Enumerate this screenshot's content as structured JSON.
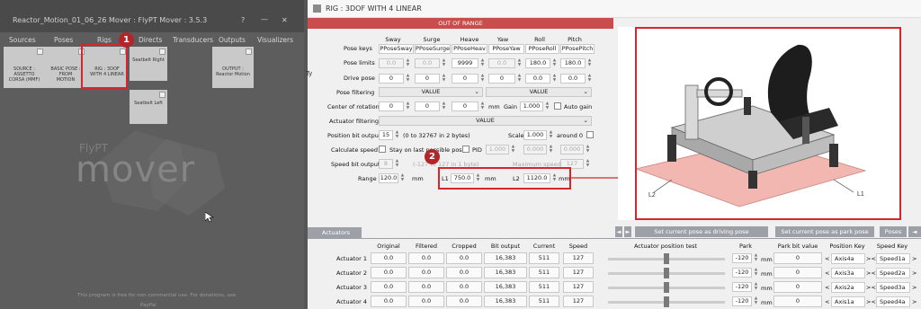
{
  "main_window": {
    "title": "Reactor_Motion_01_06_26 Mover : FlyPT Mover : 3.5.3",
    "win_controls": [
      "?",
      "—",
      "✕"
    ],
    "tabs": [
      "Sources",
      "Poses",
      "Rigs",
      "Directs",
      "Transducers",
      "Outputs",
      "Visualizers"
    ],
    "tiles": {
      "source": "SOURCE :\nASSETTO\nCORSA (MMF)",
      "pose": "BASIC POSE :\nFROM\nMOTION",
      "rig": "RIG : 3DOF\nWITH 4 LINEAR",
      "directs": "Seatbelt Right",
      "output": "OUTPUT :\nReactor Motion",
      "directs2": "Seatbelt Left"
    },
    "logo_small": "FlyPT",
    "logo_big": "mover",
    "footer": "This program is free for non commercial use. For donations, use",
    "footer2": "PayPal",
    "markers": {
      "one": "1",
      "two": "2"
    }
  },
  "rig_window": {
    "title": "RIG : 3DOF WITH 4 LINEAR",
    "banner": "OUT OF RANGE",
    "side_label": "Ty",
    "headers": [
      "Sway",
      "Surge",
      "Heave",
      "Yaw",
      "Roll",
      "Pitch"
    ],
    "pose_keys": {
      "label": "Pose keys",
      "values": [
        "PPoseSway",
        "PPoseSurge",
        "PPoseHeav",
        "PPoseYaw",
        "PPoseRoll",
        "PPosePitch"
      ]
    },
    "pose_limits": {
      "label": "Pose limits",
      "values": [
        "0.0",
        "0.0",
        "9999",
        "0.0",
        "180.0",
        "180.0"
      ]
    },
    "drive_pose": {
      "label": "Drive pose",
      "values": [
        "0",
        "0",
        "0",
        "0",
        "0.0",
        "0.0"
      ]
    },
    "pose_filtering": {
      "label": "Pose filtering",
      "left": "VALUE",
      "right": "VALUE"
    },
    "center_of_rotation": {
      "label": "Center of rotation",
      "values": [
        "0",
        "0",
        "0"
      ],
      "unit": "mm",
      "gain_label": "Gain",
      "gain": "1.000",
      "auto_gain": "Auto gain"
    },
    "actuator_filtering": {
      "label": "Actuator filtering",
      "value": "VALUE"
    },
    "position_bit_output": {
      "label": "Position bit output",
      "value": "15",
      "note": "(0 to 32767 in 2 bytes)",
      "scale_label": "Scale",
      "scale": "1.000",
      "around": "around 0"
    },
    "calculate_speed": {
      "label": "Calculate speed",
      "stay": "Stay on last possible pose",
      "pid": "PID",
      "pid1": "1.000",
      "pid2": "0.000",
      "pid3": "0.000"
    },
    "speed_bit_output": {
      "label": "Speed bit output",
      "value": "8",
      "note": "(-127 to 127 in 1 byte)",
      "max_label": "Maximum speed",
      "max": "127"
    },
    "range": {
      "label": "Range",
      "value": "120.0",
      "unit": "mm",
      "l1_label": "L1",
      "l1": "750.0",
      "l1_unit": "mm",
      "l2_label": "L2",
      "l2": "1120.0",
      "l2_unit": "mm"
    },
    "diagram_labels": {
      "l1": "L1",
      "l2": "L2"
    },
    "buttons": {
      "driving": "Set current pose as driving pose",
      "park": "Set current pose as park pose",
      "poses": "Poses"
    },
    "nav_arrows": {
      "left": "◄",
      "right": "►"
    },
    "actuators_tab": "Actuators",
    "grid_headers": [
      "Original",
      "Filtered",
      "Cropped",
      "Bit output",
      "Current",
      "Speed",
      "Actuator position test",
      "Park",
      "Park bit value",
      "Position Key",
      "Speed Key"
    ],
    "actuators": [
      {
        "name": "Actuator 1",
        "original": "0.0",
        "filtered": "0.0",
        "cropped": "0.0",
        "bit": "16,383",
        "current": "511",
        "speed": "127",
        "park": "-120",
        "unit": "mm",
        "park_bit": "0",
        "pos_key": "Axis4a",
        "speed_key": "Speed1a"
      },
      {
        "name": "Actuator 2",
        "original": "0.0",
        "filtered": "0.0",
        "cropped": "0.0",
        "bit": "16,383",
        "current": "511",
        "speed": "127",
        "park": "-120",
        "unit": "mm",
        "park_bit": "0",
        "pos_key": "Axis3a",
        "speed_key": "Speed2a"
      },
      {
        "name": "Actuator 3",
        "original": "0.0",
        "filtered": "0.0",
        "cropped": "0.0",
        "bit": "16,383",
        "current": "511",
        "speed": "127",
        "park": "-120",
        "unit": "mm",
        "park_bit": "0",
        "pos_key": "Axis2a",
        "speed_key": "Speed3a"
      },
      {
        "name": "Actuator 4",
        "original": "0.0",
        "filtered": "0.0",
        "cropped": "0.0",
        "bit": "16,383",
        "current": "511",
        "speed": "127",
        "park": "-120",
        "unit": "mm",
        "park_bit": "0",
        "pos_key": "Axis1a",
        "speed_key": "Speed4a"
      }
    ]
  },
  "colors": {
    "highlight": "#d5262c",
    "range_warning": "#f3b7b1",
    "button_bar": "#9ea0a8"
  }
}
